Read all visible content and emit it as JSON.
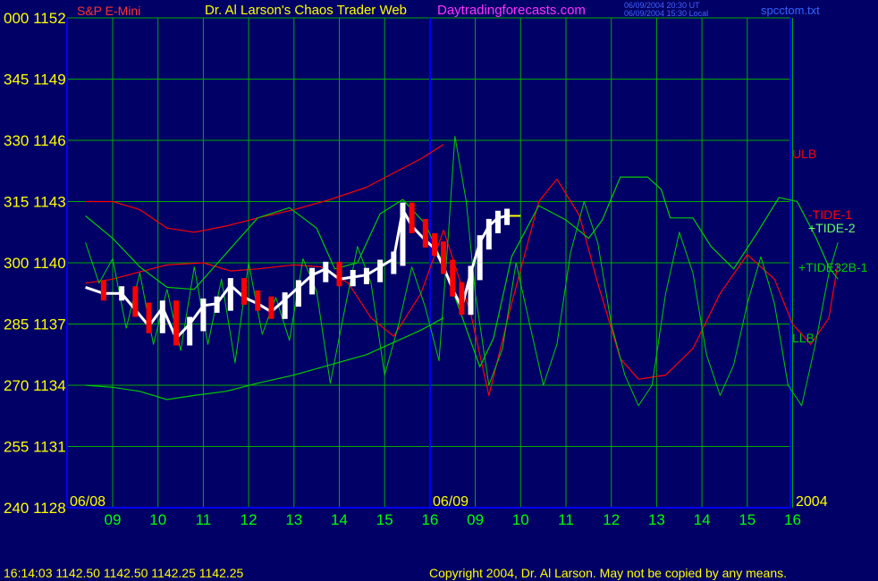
{
  "header": {
    "instrument": "S&P E-Mini",
    "site_title": "Dr. Al Larson's Chaos Trader Web",
    "site_url": "Daytradingforecasts.com",
    "timestamp_ut": "06/09/2004 20:30 UT",
    "timestamp_local": "06/09/2004 15:30 Local",
    "filename": "spcctom.txt"
  },
  "footer": {
    "quote": "16:14:03  1142.50 1142.50 1142.25 1142.25",
    "copyright": "Copyright 2004, Dr. Al Larson. May not be copied by any means."
  },
  "colors": {
    "background": "#000066",
    "grid": "#00AA00",
    "axis": "#0000FF",
    "tick_text": "#FFFF00",
    "hour_text": "#00FF00",
    "ulb": "#FF0000",
    "llb": "#00CC00",
    "tide1": "#FF0000",
    "tide2": "#00CC00",
    "tide32": "#00CC00",
    "price_up": "#FFFFFF",
    "price_down": "#FF0000",
    "last_price": "#FFFF00"
  },
  "chart_data": {
    "type": "line",
    "y_left_ticks": [
      {
        "angle": "000",
        "price": "1152"
      },
      {
        "angle": "345",
        "price": "1149"
      },
      {
        "angle": "330",
        "price": "1146"
      },
      {
        "angle": "315",
        "price": "1143"
      },
      {
        "angle": "300",
        "price": "1140"
      },
      {
        "angle": "285",
        "price": "1137"
      },
      {
        "angle": "270",
        "price": "1134"
      },
      {
        "angle": "255",
        "price": "1131"
      },
      {
        "angle": "240",
        "price": "1128"
      }
    ],
    "ylim": [
      1128,
      1152
    ],
    "x_hours": [
      "09",
      "10",
      "11",
      "12",
      "13",
      "14",
      "15",
      "16",
      "09",
      "10",
      "11",
      "12",
      "13",
      "14",
      "15",
      "16"
    ],
    "date_labels": [
      "06/08",
      "06/09",
      "2004"
    ],
    "xlim": [
      0,
      16
    ],
    "series_labels": {
      "ulb": "ULB",
      "tide1": "-TIDE-1",
      "tide2": "+TIDE-2",
      "tide32": "+TIDE32B-1",
      "llb": "LLB"
    },
    "series": [
      {
        "key": "ulb",
        "points": [
          [
            -0.6,
            1143.0
          ],
          [
            0,
            1143.0
          ],
          [
            0.6,
            1142.6
          ],
          [
            1.2,
            1141.7
          ],
          [
            1.8,
            1141.5
          ],
          [
            2.5,
            1141.8
          ],
          [
            3.2,
            1142.2
          ],
          [
            4,
            1142.6
          ],
          [
            4.8,
            1143.1
          ],
          [
            5.6,
            1143.7
          ],
          [
            6.2,
            1144.4
          ],
          [
            6.8,
            1145.1
          ],
          [
            7.3,
            1145.8
          ]
        ]
      },
      {
        "key": "llb",
        "points": [
          [
            -0.6,
            1134.0
          ],
          [
            0,
            1133.9
          ],
          [
            0.6,
            1133.7
          ],
          [
            1.2,
            1133.3
          ],
          [
            1.8,
            1133.5
          ],
          [
            2.5,
            1133.7
          ],
          [
            3.2,
            1134.1
          ],
          [
            4,
            1134.5
          ],
          [
            4.8,
            1135.0
          ],
          [
            5.6,
            1135.5
          ],
          [
            6.2,
            1136.1
          ],
          [
            6.8,
            1136.7
          ],
          [
            7.3,
            1137.3
          ]
        ]
      },
      {
        "key": "tide1",
        "points": [
          [
            -0.6,
            1139.0
          ],
          [
            0,
            1139.2
          ],
          [
            0.5,
            1139.5
          ],
          [
            1.2,
            1139.9
          ],
          [
            2,
            1140.0
          ],
          [
            2.6,
            1139.6
          ],
          [
            3.2,
            1139.7
          ],
          [
            4,
            1139.9
          ],
          [
            4.6,
            1139.8
          ],
          [
            5.2,
            1139.0
          ],
          [
            5.7,
            1137.3
          ],
          [
            6.2,
            1136.4
          ],
          [
            6.8,
            1138.5
          ],
          [
            7.3,
            1141.6
          ],
          [
            7.9,
            1137.5
          ],
          [
            8.3,
            1133.5
          ],
          [
            8.8,
            1138.0
          ],
          [
            9.4,
            1143.0
          ],
          [
            9.8,
            1144.1
          ],
          [
            10.3,
            1142.3
          ],
          [
            10.7,
            1139.0
          ],
          [
            11.2,
            1135.3
          ],
          [
            11.6,
            1134.3
          ],
          [
            12.2,
            1134.5
          ],
          [
            12.8,
            1135.8
          ],
          [
            13.4,
            1138.5
          ],
          [
            14,
            1140.4
          ],
          [
            14.6,
            1139.2
          ],
          [
            15.0,
            1137.0
          ],
          [
            15.4,
            1136.0
          ],
          [
            15.8,
            1137.3
          ],
          [
            16,
            1140.0
          ]
        ]
      },
      {
        "key": "tide2",
        "points": [
          [
            -0.6,
            1142.3
          ],
          [
            0,
            1141.2
          ],
          [
            0.6,
            1139.8
          ],
          [
            1.2,
            1138.8
          ],
          [
            1.8,
            1138.7
          ],
          [
            2.4,
            1140.2
          ],
          [
            3.2,
            1142.2
          ],
          [
            3.9,
            1142.7
          ],
          [
            4.5,
            1141.7
          ],
          [
            4.9,
            1139.7
          ],
          [
            5.4,
            1140.0
          ],
          [
            5.9,
            1142.4
          ],
          [
            6.4,
            1143.1
          ],
          [
            6.9,
            1141.9
          ],
          [
            7.3,
            1139.9
          ],
          [
            7.7,
            1137.4
          ],
          [
            8.1,
            1134.9
          ],
          [
            8.4,
            1136.3
          ],
          [
            8.8,
            1140.3
          ],
          [
            9.4,
            1142.8
          ],
          [
            10.0,
            1142.1
          ],
          [
            10.5,
            1141.2
          ],
          [
            10.8,
            1142.1
          ],
          [
            11.2,
            1144.2
          ],
          [
            11.8,
            1144.2
          ],
          [
            12.1,
            1143.6
          ],
          [
            12.3,
            1142.2
          ],
          [
            12.8,
            1142.2
          ],
          [
            13.2,
            1140.8
          ],
          [
            13.7,
            1139.7
          ],
          [
            14.2,
            1141.4
          ],
          [
            14.7,
            1143.2
          ],
          [
            15.1,
            1143.0
          ],
          [
            15.5,
            1141.3
          ],
          [
            15.8,
            1139.8
          ],
          [
            16,
            1139.2
          ]
        ]
      },
      {
        "key": "tide32",
        "points": [
          [
            -0.6,
            1141.0
          ],
          [
            -0.3,
            1139.0
          ],
          [
            0,
            1140.2
          ],
          [
            0.3,
            1136.8
          ],
          [
            0.6,
            1139.5
          ],
          [
            0.9,
            1136.0
          ],
          [
            1.2,
            1138.7
          ],
          [
            1.5,
            1135.7
          ],
          [
            1.8,
            1139.8
          ],
          [
            2.1,
            1136.0
          ],
          [
            2.4,
            1139.2
          ],
          [
            2.7,
            1135.1
          ],
          [
            3.0,
            1140.0
          ],
          [
            3.3,
            1136.5
          ],
          [
            3.6,
            1138.3
          ],
          [
            3.9,
            1136.2
          ],
          [
            4.2,
            1140.2
          ],
          [
            4.5,
            1138.6
          ],
          [
            4.8,
            1134.1
          ],
          [
            5.1,
            1137.5
          ],
          [
            5.4,
            1140.8
          ],
          [
            5.7,
            1139.0
          ],
          [
            6.0,
            1134.5
          ],
          [
            6.3,
            1136.9
          ],
          [
            6.6,
            1139.8
          ],
          [
            6.9,
            1137.8
          ],
          [
            7.2,
            1135.2
          ],
          [
            7.4,
            1141.2
          ],
          [
            7.55,
            1146.2
          ],
          [
            7.8,
            1143.0
          ],
          [
            8.0,
            1138.5
          ],
          [
            8.3,
            1134.0
          ],
          [
            8.6,
            1135.8
          ],
          [
            8.9,
            1140.0
          ],
          [
            9.2,
            1137.0
          ],
          [
            9.5,
            1134.0
          ],
          [
            9.8,
            1136.0
          ],
          [
            10.1,
            1140.5
          ],
          [
            10.4,
            1143.0
          ],
          [
            10.7,
            1141.0
          ],
          [
            11.0,
            1137.0
          ],
          [
            11.3,
            1134.5
          ],
          [
            11.6,
            1133.0
          ],
          [
            11.9,
            1134.0
          ],
          [
            12.2,
            1138.5
          ],
          [
            12.5,
            1141.5
          ],
          [
            12.8,
            1139.5
          ],
          [
            13.1,
            1135.5
          ],
          [
            13.4,
            1133.5
          ],
          [
            13.7,
            1135.0
          ],
          [
            14.0,
            1138.0
          ],
          [
            14.3,
            1140.3
          ],
          [
            14.6,
            1138.0
          ],
          [
            14.9,
            1134.0
          ],
          [
            15.2,
            1133.0
          ],
          [
            15.5,
            1136.0
          ],
          [
            15.8,
            1139.5
          ],
          [
            16,
            1141.0
          ]
        ]
      },
      {
        "key": "price",
        "points": [
          [
            -0.6,
            1138.8
          ],
          [
            -0.2,
            1138.5
          ],
          [
            0.2,
            1138.5
          ],
          [
            0.5,
            1137.7
          ],
          [
            0.8,
            1136.9
          ],
          [
            1.1,
            1137.8
          ],
          [
            1.4,
            1136.3
          ],
          [
            1.7,
            1137.0
          ],
          [
            2.0,
            1137.9
          ],
          [
            2.3,
            1138.0
          ],
          [
            2.6,
            1138.9
          ],
          [
            2.9,
            1138.3
          ],
          [
            3.2,
            1138.0
          ],
          [
            3.5,
            1137.6
          ],
          [
            3.8,
            1138.2
          ],
          [
            4.1,
            1138.8
          ],
          [
            4.4,
            1139.4
          ],
          [
            4.7,
            1139.7
          ],
          [
            5.0,
            1139.2
          ],
          [
            5.3,
            1139.3
          ],
          [
            5.6,
            1139.4
          ],
          [
            5.9,
            1139.8
          ],
          [
            6.2,
            1140.2
          ],
          [
            6.4,
            1142.6
          ],
          [
            6.6,
            1141.8
          ],
          [
            6.9,
            1141.1
          ],
          [
            7.1,
            1140.7
          ],
          [
            7.3,
            1139.8
          ],
          [
            7.5,
            1138.7
          ],
          [
            7.7,
            1137.8
          ],
          [
            7.9,
            1139.5
          ],
          [
            8.1,
            1141.0
          ],
          [
            8.3,
            1141.8
          ],
          [
            8.5,
            1142.2
          ],
          [
            8.7,
            1142.3
          ]
        ]
      },
      {
        "key": "last",
        "points": [
          [
            8.7,
            1142.3
          ],
          [
            9.0,
            1142.3
          ]
        ]
      }
    ]
  }
}
